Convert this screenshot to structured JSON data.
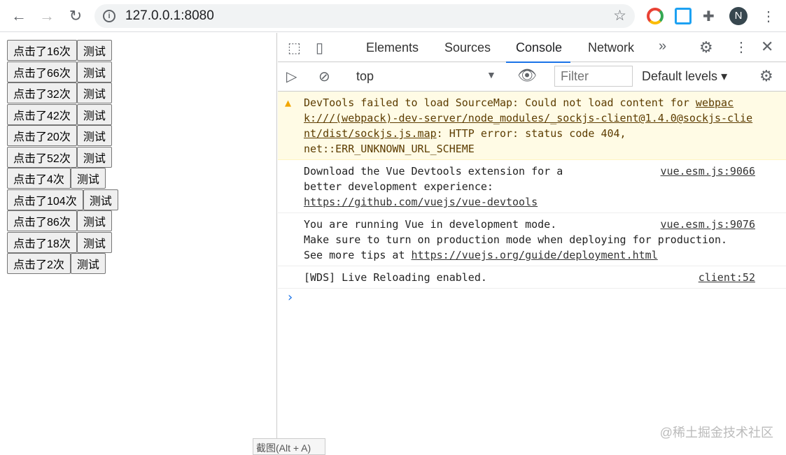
{
  "browser": {
    "url": "127.0.0.1:8080",
    "avatar": "N"
  },
  "page": {
    "rows": [
      {
        "count": "点击了16次",
        "test": "测试"
      },
      {
        "count": "点击了66次",
        "test": "测试"
      },
      {
        "count": "点击了32次",
        "test": "测试"
      },
      {
        "count": "点击了42次",
        "test": "测试"
      },
      {
        "count": "点击了20次",
        "test": "测试"
      },
      {
        "count": "点击了52次",
        "test": "测试"
      },
      {
        "count": "点击了4次",
        "test": "测试"
      },
      {
        "count": "点击了104次",
        "test": "测试"
      },
      {
        "count": "点击了86次",
        "test": "测试"
      },
      {
        "count": "点击了18次",
        "test": "测试"
      },
      {
        "count": "点击了2次",
        "test": "测试"
      }
    ]
  },
  "devtools": {
    "tabs": [
      "Elements",
      "Sources",
      "Console",
      "Network"
    ],
    "context": "top",
    "filter_placeholder": "Filter",
    "levels": "Default levels",
    "messages": [
      {
        "text": "DevTools failed to load SourceMap: Could not load content for ",
        "link": "webpack:///(webpack)-dev-server/node_modules/_sockjs-client@1.4.0@sockjs-client/dist/sockjs.js.map",
        "rest": ": HTTP error: status code 404, net::ERR_UNKNOWN_URL_SCHEME"
      },
      {
        "text": "Download the Vue Devtools extension for a better development experience:\n",
        "link": "https://github.com/vuejs/vue-devtools",
        "source": "vue.esm.js:9066"
      },
      {
        "text": "You are running Vue in development mode.\nMake sure to turn on production mode when deploying for production.\nSee more tips at ",
        "link": "https://vuejs.org/guide/deployment.html",
        "source": "vue.esm.js:9076"
      },
      {
        "text": "[WDS] Live Reloading enabled.",
        "source": "client:52"
      }
    ],
    "prompt": "›"
  },
  "screenshot_tip": "截图(Alt + A)",
  "watermark": "@稀土掘金技术社区"
}
